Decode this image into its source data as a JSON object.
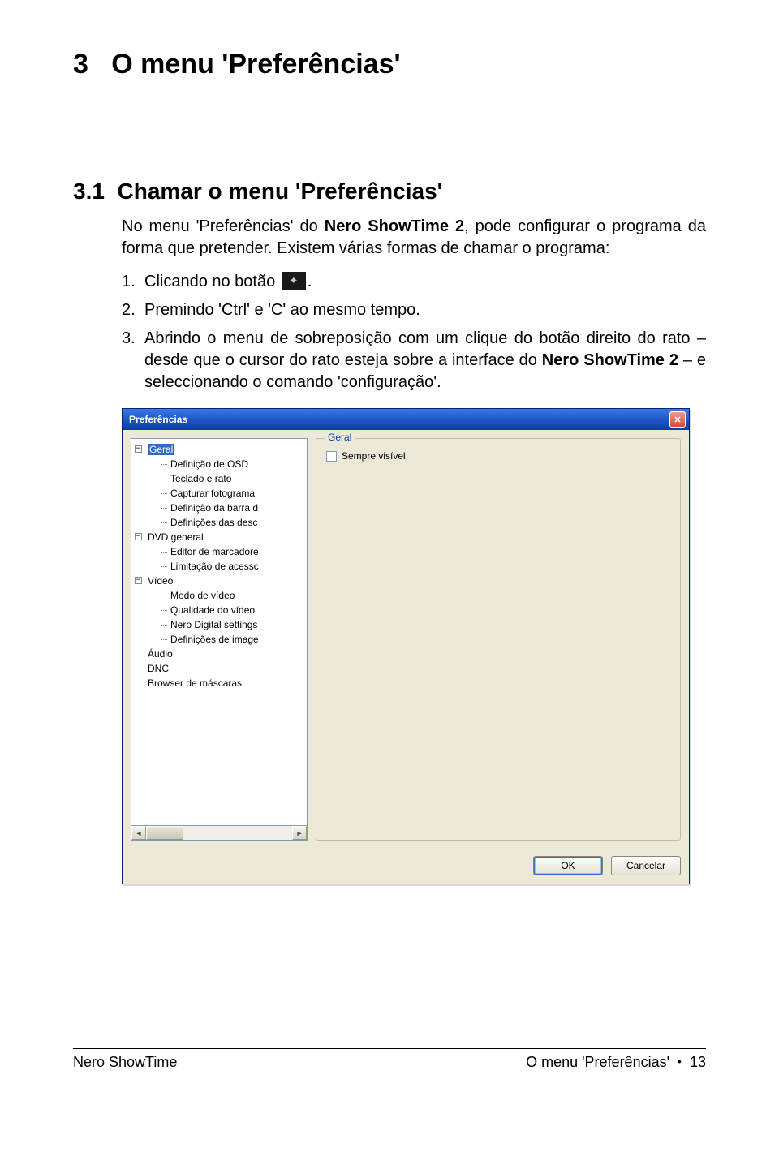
{
  "chapter": {
    "num": "3",
    "title": "O menu 'Preferências'"
  },
  "section": {
    "num": "3.1",
    "title": "Chamar o menu 'Preferências'"
  },
  "intro": {
    "p1a": "No menu 'Preferências' do ",
    "p1b": "Nero ShowTime 2",
    "p1c": ", pode configurar o programa da forma que pretender. Existem várias formas de chamar o programa:"
  },
  "steps": {
    "s1a": "Clicando no botão ",
    "s1b": ".",
    "s2": "Premindo 'Ctrl' e 'C' ao mesmo tempo.",
    "s3a": "Abrindo o menu de sobreposição com um clique do botão direito do rato – desde que o cursor do rato esteja sobre a interface do ",
    "s3b": "Nero ShowTime 2",
    "s3c": " – e seleccionando o comando 'configuração'."
  },
  "dialog": {
    "title": "Preferências",
    "tree": {
      "geral": {
        "label": "Geral",
        "children": [
          "Definição de OSD",
          "Teclado e rato",
          "Capturar fotograma",
          "Definição da barra d",
          "Definições das desc"
        ]
      },
      "dvd": {
        "label": "DVD general",
        "children": [
          "Editor de marcadore",
          "Limitação de acessc"
        ]
      },
      "video": {
        "label": "Vídeo",
        "children": [
          "Modo de vídeo",
          "Qualidade do vídeo",
          "Nero Digital settings",
          "Definições de image"
        ]
      },
      "audio": {
        "label": "Áudio"
      },
      "dnc": {
        "label": "DNC"
      },
      "browser": {
        "label": "Browser de máscaras"
      }
    },
    "group_legend": "Geral",
    "checkbox_label": "Sempre visível",
    "ok": "OK",
    "cancel": "Cancelar"
  },
  "footer": {
    "left": "Nero ShowTime",
    "right_text": "O menu 'Preferências'",
    "page": "13"
  }
}
